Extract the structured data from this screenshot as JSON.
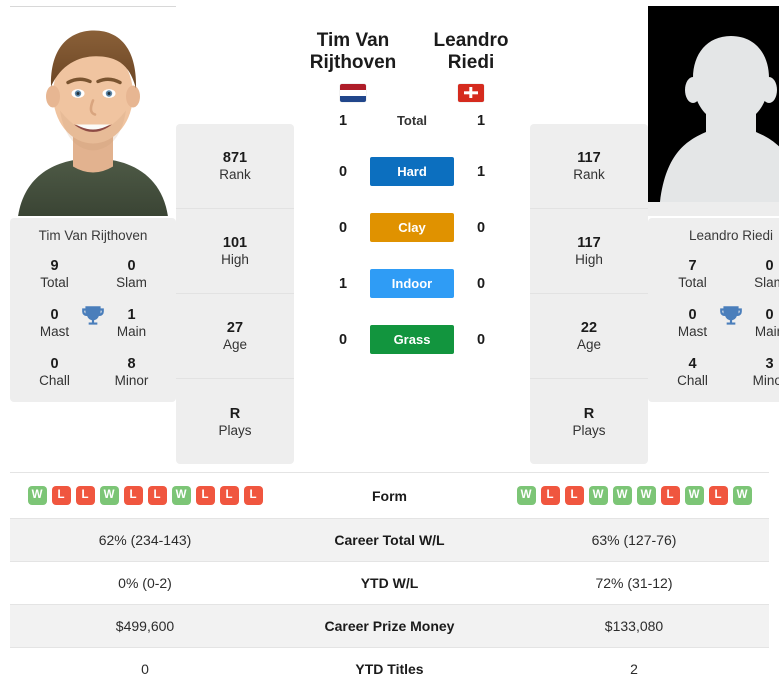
{
  "players": {
    "left": {
      "name_line1": "Tim Van",
      "name_line2": "Rijthoven",
      "full_name": "Tim Van Rijthoven",
      "flag": "nl-flag-icon",
      "photo": "player-photo",
      "rank": "871",
      "rank_label": "Rank",
      "high": "101",
      "high_label": "High",
      "age": "27",
      "age_label": "Age",
      "plays": "R",
      "plays_label": "Plays",
      "titles": {
        "total": "9",
        "total_label": "Total",
        "slam": "0",
        "slam_label": "Slam",
        "mast": "0",
        "mast_label": "Mast",
        "main": "1",
        "main_label": "Main",
        "chall": "0",
        "chall_label": "Chall",
        "minor": "8",
        "minor_label": "Minor"
      },
      "h2h": {
        "total": "1",
        "hard": "0",
        "clay": "0",
        "indoor": "1",
        "grass": "0"
      },
      "form": [
        "W",
        "L",
        "L",
        "W",
        "L",
        "L",
        "W",
        "L",
        "L",
        "L"
      ],
      "career_wl": "62% (234-143)",
      "ytd_wl": "0% (0-2)",
      "prize_money": "$499,600",
      "ytd_titles": "0"
    },
    "right": {
      "name_line1": "Leandro",
      "name_line2": "Riedi",
      "full_name": "Leandro Riedi",
      "flag": "ch-flag-icon",
      "photo": "player-photo-placeholder",
      "rank": "117",
      "rank_label": "Rank",
      "high": "117",
      "high_label": "High",
      "age": "22",
      "age_label": "Age",
      "plays": "R",
      "plays_label": "Plays",
      "titles": {
        "total": "7",
        "total_label": "Total",
        "slam": "0",
        "slam_label": "Slam",
        "mast": "0",
        "mast_label": "Mast",
        "main": "0",
        "main_label": "Main",
        "chall": "4",
        "chall_label": "Chall",
        "minor": "3",
        "minor_label": "Minor"
      },
      "h2h": {
        "total": "1",
        "hard": "1",
        "clay": "0",
        "indoor": "0",
        "grass": "0"
      },
      "form": [
        "W",
        "L",
        "L",
        "W",
        "W",
        "W",
        "L",
        "W",
        "L",
        "W"
      ],
      "career_wl": "63% (127-76)",
      "ytd_wl": "72% (31-12)",
      "prize_money": "$133,080",
      "ytd_titles": "2"
    }
  },
  "surfaces": {
    "total_label": "Total",
    "hard_label": "Hard",
    "clay_label": "Clay",
    "indoor_label": "Indoor",
    "grass_label": "Grass",
    "colors": {
      "hard": "#0c6fbf",
      "clay": "#e09200",
      "indoor": "#2f9cf5",
      "grass": "#12953e"
    }
  },
  "table": {
    "rows": [
      {
        "label": "Form",
        "type": "form"
      },
      {
        "label": "Career Total W/L",
        "type": "text",
        "left": "62% (234-143)",
        "right": "63% (127-76)"
      },
      {
        "label": "YTD W/L",
        "type": "text",
        "left": "0% (0-2)",
        "right": "72% (31-12)"
      },
      {
        "label": "Career Prize Money",
        "type": "text",
        "left": "$499,600",
        "right": "$133,080"
      },
      {
        "label": "YTD Titles",
        "type": "text",
        "left": "0",
        "right": "2"
      }
    ]
  },
  "icons": {
    "trophy": "trophy-icon"
  },
  "theme": {
    "card_bg": "#eeeeee",
    "alt_row_bg": "#f2f2f2",
    "win_color": "#7cc576",
    "loss_color": "#f0563f",
    "trophy_color": "#4a7ebb"
  }
}
